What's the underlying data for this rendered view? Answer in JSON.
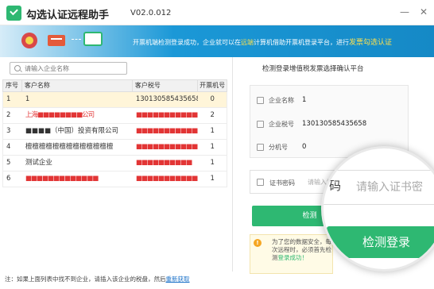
{
  "window": {
    "title": "勾选认证远程助手",
    "version": "V02.0.012",
    "minimize_icon": "minimize-icon",
    "close_icon": "close-icon"
  },
  "banner": {
    "text_1": "开票机端检测登录成功，企业就可以在",
    "hl_1": "远端",
    "text_2": "计算机借助开票机登录平台，进行",
    "hl_2": "发票勾选认证"
  },
  "search": {
    "placeholder": "请输入企业名称"
  },
  "table": {
    "headers": [
      "序号",
      "客户名称",
      "客户税号",
      "开票机号"
    ],
    "rows": [
      {
        "no": "1",
        "name": "1",
        "tax": "130130585435658",
        "count": "0"
      },
      {
        "no": "2",
        "name": "上海■■■■■■■■公司",
        "tax": "■■■■■■■■■■■■■",
        "count": "2"
      },
      {
        "no": "3",
        "name": "■■■■（中国）投资有限公司",
        "tax": "■■■■■■■■■■■■■",
        "count": "1"
      },
      {
        "no": "4",
        "name": "檀檀檀檀檀檀檀檀檀檀檀檀檀",
        "tax": "■■■■■■■■■■■■■",
        "count": "1"
      },
      {
        "no": "5",
        "name": "测试企业",
        "tax": "■■■■■■■■■■",
        "count": "1"
      },
      {
        "no": "6",
        "name": "■■■■■■■■■■■■■",
        "tax": "■■■■■■■■■■■■■",
        "count": "1"
      }
    ]
  },
  "panel": {
    "title": "检测登录增值税发票选择确认平台",
    "company_label": "企业名称",
    "company_value": "1",
    "tax_label": "企业税号",
    "tax_value": "130130585435658",
    "branch_label": "分机号",
    "branch_value": "0",
    "cert_label": "证书密码",
    "cert_placeholder": "请输入证书",
    "check_button": "检测",
    "notice_1": "为了您的数据安全，",
    "notice_2": "每次远程时，必须首先检测",
    "notice_3": "登录成功！"
  },
  "magnifier": {
    "label_tail": "码",
    "placeholder": "请输入证书密",
    "button": "检测登录"
  },
  "footer": {
    "text": "注：如果上面列表中找不到企业，请插入该企业的税盘，然后",
    "link": "重新获取"
  }
}
